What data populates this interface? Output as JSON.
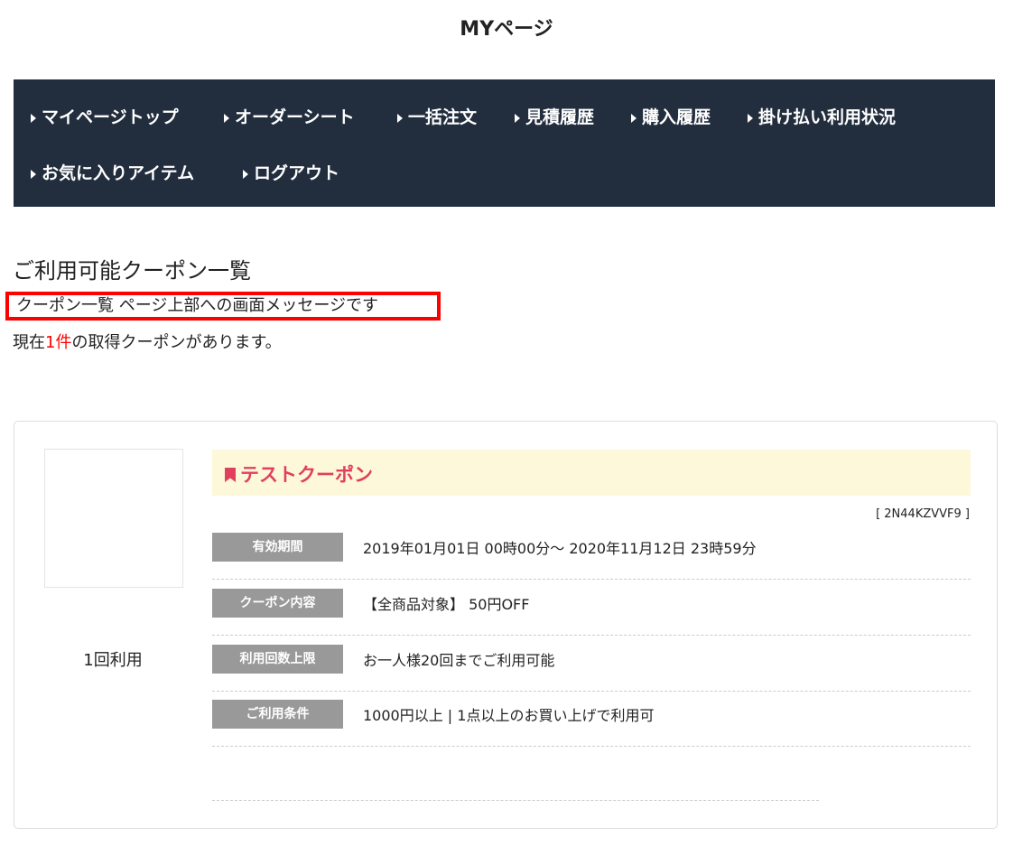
{
  "page_title": "MYページ",
  "nav": [
    "マイページトップ",
    "オーダーシート",
    "一括注文",
    "見積履歴",
    "購入履歴",
    "掛け払い利用状況",
    "お気に入りアイテム",
    "ログアウト"
  ],
  "section_title": "ご利用可能クーポン一覧",
  "message": "クーポン一覧 ページ上部への画面メッセージです",
  "count": {
    "prefix": "現在",
    "number": "1件",
    "suffix": "の取得クーポンがあります。"
  },
  "coupon": {
    "name": "テストクーポン",
    "code": "[ 2N44KZVVF9 ]",
    "usage": "1回利用",
    "rows": [
      {
        "label": "有効期間",
        "value": "2019年01月01日 00時00分～ 2020年11月12日 23時59分"
      },
      {
        "label": "クーポン内容",
        "value": "【全商品対象】 50円OFF"
      },
      {
        "label": "利用回数上限",
        "value": "お一人様20回までご利用可能"
      },
      {
        "label": "ご利用条件",
        "value": "1000円以上 | 1点以上のお買い上げで利用可"
      }
    ]
  }
}
